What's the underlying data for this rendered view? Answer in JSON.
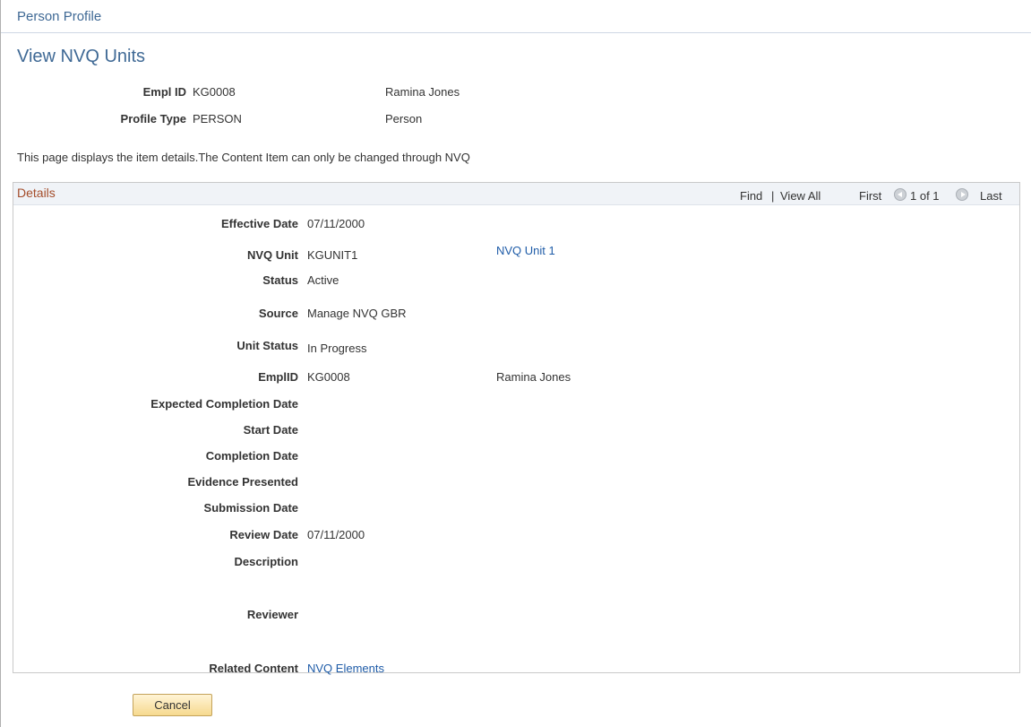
{
  "breadcrumb": "Person Profile",
  "page_title": "View NVQ Units",
  "header": {
    "empl_id_label": "Empl ID",
    "empl_id": "KG0008",
    "name": "Ramina Jones",
    "profile_type_label": "Profile Type",
    "profile_type": "PERSON",
    "profile_type_desc": "Person"
  },
  "note": "This page displays the item details.The Content Item can only be changed through NVQ",
  "details": {
    "title": "Details",
    "find": "Find",
    "separator": "|",
    "view_all": "View All",
    "first": "First",
    "count": "1 of 1",
    "last": "Last",
    "fields": {
      "effective_date_label": "Effective Date",
      "effective_date": "07/11/2000",
      "nvq_unit_label": "NVQ Unit",
      "nvq_unit": "KGUNIT1",
      "nvq_unit_link": "NVQ Unit 1",
      "status_label": "Status",
      "status": "Active",
      "source_label": "Source",
      "source": "Manage NVQ GBR",
      "unit_status_label": "Unit Status",
      "unit_status": "In Progress",
      "emplid_label": "EmplID",
      "emplid": "KG0008",
      "emplid_name": "Ramina Jones",
      "expected_completion_label": "Expected Completion Date",
      "start_date_label": "Start Date",
      "completion_date_label": "Completion Date",
      "evidence_presented_label": "Evidence Presented",
      "submission_date_label": "Submission Date",
      "review_date_label": "Review Date",
      "review_date": "07/11/2000",
      "description_label": "Description",
      "reviewer_label": "Reviewer",
      "related_content_label": "Related Content",
      "related_content_link": "NVQ Elements"
    }
  },
  "cancel_label": "Cancel"
}
